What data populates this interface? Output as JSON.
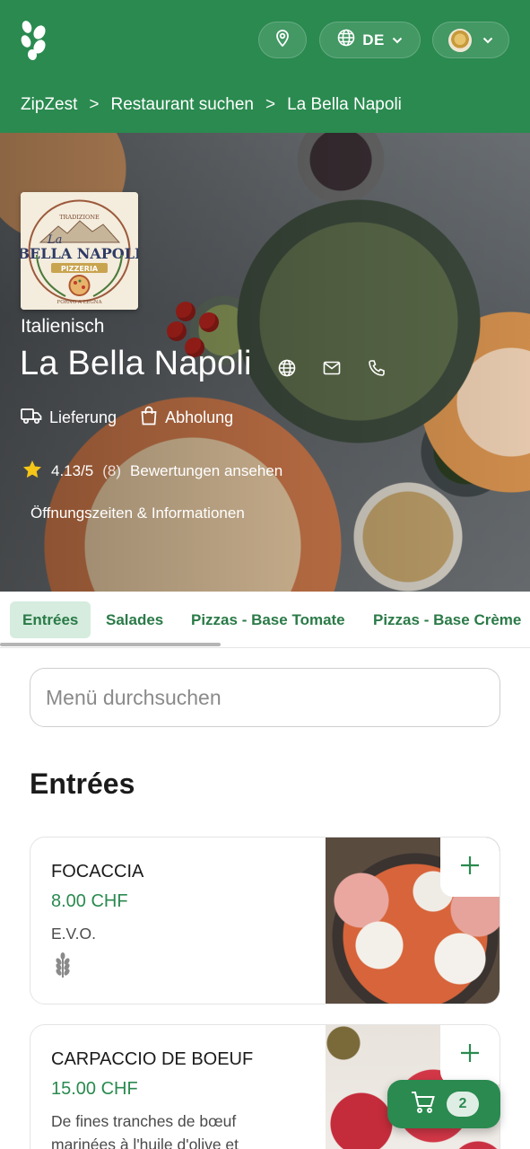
{
  "header": {
    "language": "DE",
    "breadcrumb": [
      "ZipZest",
      "Restaurant suchen",
      "La Bella Napoli"
    ]
  },
  "restaurant": {
    "logo_text": [
      "La",
      "BELLA NAPOLI",
      "PIZZERIA",
      "TRADIZIONE",
      "QUALITÀ",
      "FORNO A LEGNA"
    ],
    "cuisine": "Italienisch",
    "name": "La Bella Napoli",
    "modes": {
      "delivery": "Lieferung",
      "pickup": "Abholung"
    },
    "rating": {
      "score": "4.13/5",
      "count": "(8)",
      "link": "Bewertungen ansehen"
    },
    "hours_link": "Öffnungszeiten & Informationen"
  },
  "tabs": [
    {
      "label": "Entrées",
      "active": true
    },
    {
      "label": "Salades",
      "active": false
    },
    {
      "label": "Pizzas - Base Tomate",
      "active": false
    },
    {
      "label": "Pizzas - Base Crème",
      "active": false
    }
  ],
  "search": {
    "placeholder": "Menü durchsuchen"
  },
  "section": {
    "title": "Entrées"
  },
  "items": [
    {
      "name": "FOCACCIA",
      "price": "8.00 CHF",
      "desc": "E.V.O."
    },
    {
      "name": "CARPACCIO DE BOEUF",
      "price": "15.00 CHF",
      "desc": "De fines tranches de bœuf marinées à l'huile d'olive et"
    }
  ],
  "cart": {
    "count": "2"
  },
  "colors": {
    "brand_green": "#2a8a4f",
    "tab_active_bg": "#d5ecde",
    "price_green": "#2a8a4f"
  }
}
